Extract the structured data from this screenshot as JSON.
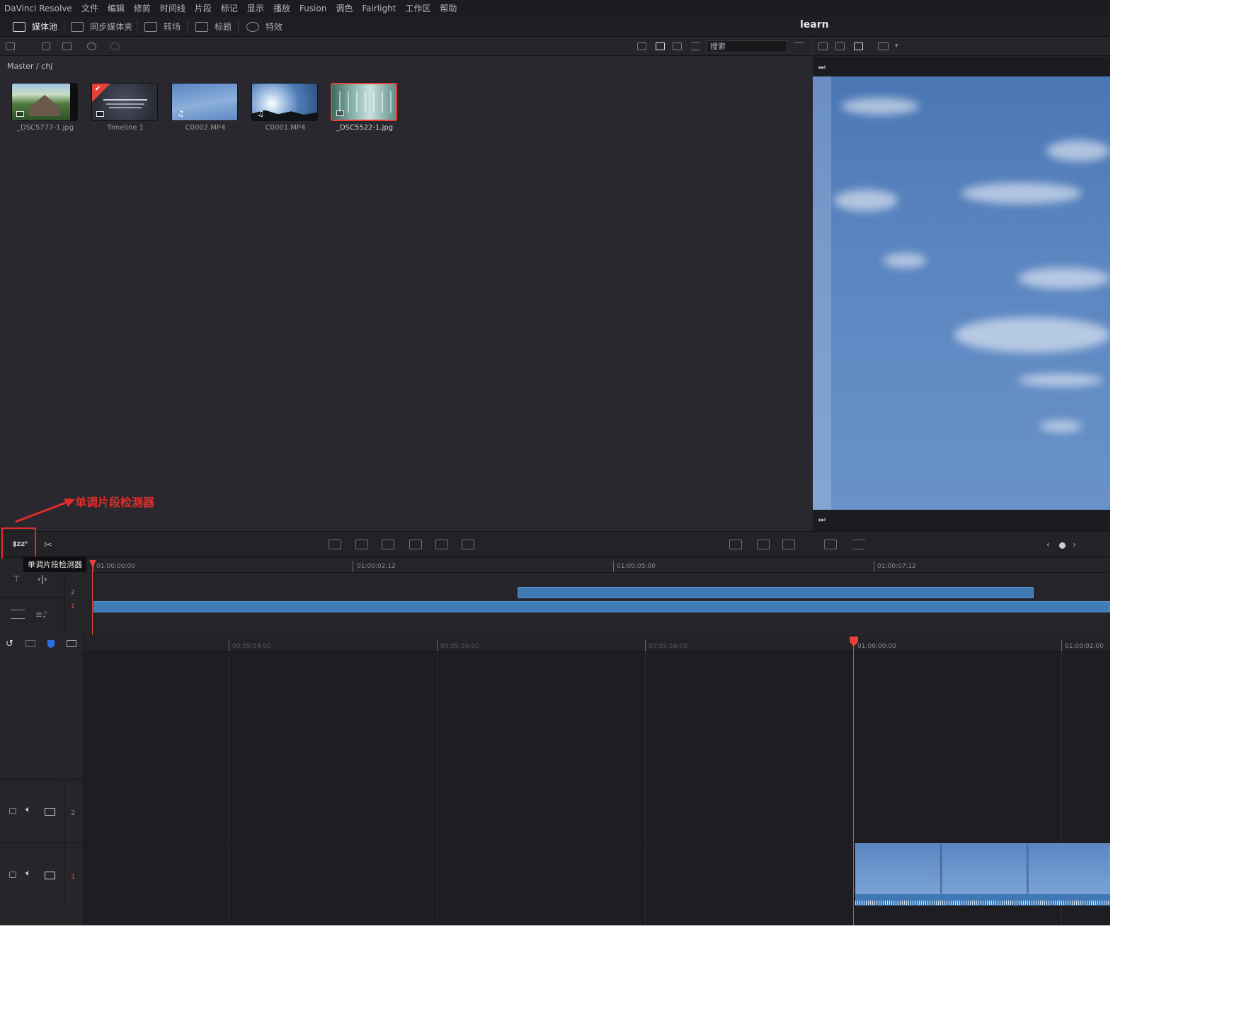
{
  "menubar": {
    "items": [
      "DaVinci Resolve",
      "文件",
      "编辑",
      "修剪",
      "时间线",
      "片段",
      "标记",
      "显示",
      "播放",
      "Fusion",
      "调色",
      "Fairlight",
      "工作区",
      "帮助"
    ]
  },
  "toolbar": {
    "media_pool": "媒体池",
    "sync_bin": "同步媒体夹",
    "transitions": "转场",
    "titles": "标题",
    "effects": "特效",
    "project_title": "learn"
  },
  "media_pool": {
    "search_placeholder": "搜索",
    "breadcrumb": "Master / chj",
    "clips": [
      {
        "name": "_DSC5777-1.jpg",
        "kind": "image",
        "selected": false
      },
      {
        "name": "Timeline 1",
        "kind": "timeline",
        "selected": false
      },
      {
        "name": "C0002.MP4",
        "kind": "audio-video",
        "selected": false
      },
      {
        "name": "C0001.MP4",
        "kind": "audio-video",
        "selected": false
      },
      {
        "name": "_DSC5522-1.jpg",
        "kind": "image",
        "selected": true
      }
    ]
  },
  "annotation": {
    "label": "单调片段检测器",
    "color": "#e02d2a"
  },
  "tooltip": {
    "text": "单调片段检测器"
  },
  "upper_timeline": {
    "timecodes": [
      "01:00:00:00",
      "01:00:02:12",
      "01:00:05:00",
      "01:00:07:12"
    ],
    "tracks": [
      "2",
      "1"
    ]
  },
  "lower_timeline": {
    "timecodes": [
      "00:59:54:00",
      "00:59:56:00",
      "00:59:58:00",
      "01:00:00:00",
      "01:00:02:00"
    ],
    "tracks": [
      "2",
      "1"
    ]
  },
  "colors": {
    "accent_red": "#e5433a",
    "clip_blue": "#3f7bb5",
    "panel_bg": "#28282e"
  }
}
